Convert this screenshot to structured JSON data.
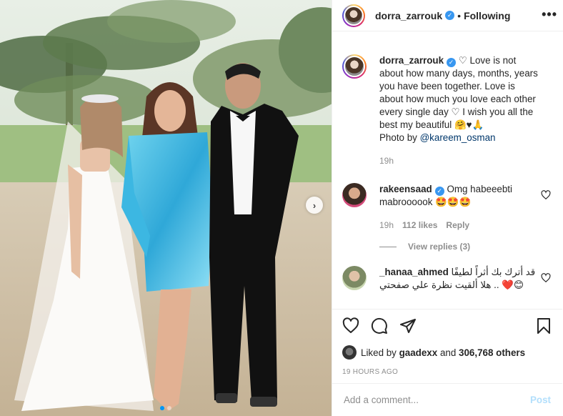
{
  "post": {
    "author": "dorra_zarrouk",
    "separator": "•",
    "follow_status": "Following",
    "more_icon": "more-horizontal-icon",
    "image_alt": "Three people posing outdoors: a bride in a white gown, a woman in a metallic blue dress, and a man in a black tuxedo"
  },
  "caption": {
    "username": "dorra_zarrouk",
    "text_part1": "Love is not about how many days, months, years you have been together. Love is about how much you love each other every single day",
    "text_part2": "I wish you all the best my beautiful",
    "emoji": "🤗♥🙏",
    "photo_credit_prefix": "Photo by",
    "photo_credit_handle": "@kareem_osman",
    "time": "19h"
  },
  "comments": [
    {
      "username": "rakeensaad",
      "text": "Omg habeeebti mabroooook",
      "emoji": "🤩🤩🤩",
      "time": "19h",
      "likes": "112 likes",
      "reply_label": "Reply",
      "view_replies": "View replies (3)"
    },
    {
      "username": "_hanaa_ahmed",
      "text": "قد أترك بك أثراً لطيفًا .. هلا ألقيت نظرة علي صفحتي",
      "emoji": "❤️😊"
    }
  ],
  "likes": {
    "prefix": "Liked by",
    "user": "gaadexx",
    "connector": "and",
    "count": "306,768 others"
  },
  "timestamp": "19 HOURS AGO",
  "add_comment": {
    "placeholder": "Add a comment...",
    "post_label": "Post"
  },
  "carousel": {
    "total": 2,
    "active_index": 0
  },
  "colors": {
    "accent": "#0095f6",
    "verified": "#3897f0",
    "link": "#00376b",
    "post_disabled": "#b2dffc"
  }
}
